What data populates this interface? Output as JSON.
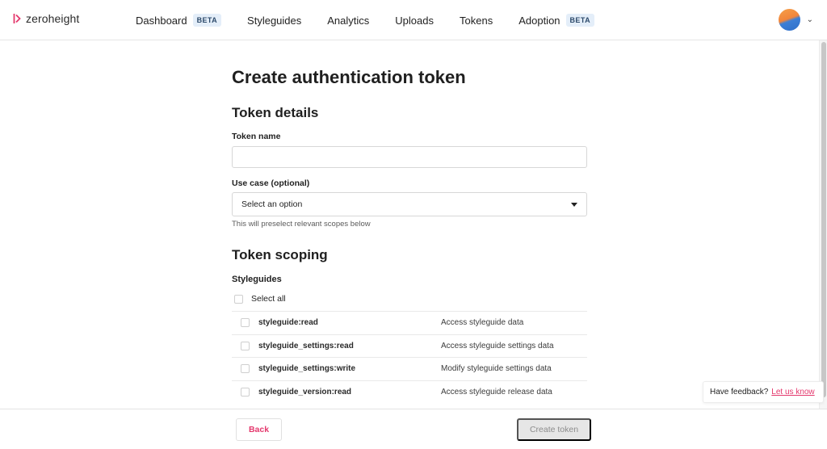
{
  "app": {
    "logo_text": "zeroheight",
    "brand_color": "#e4386d"
  },
  "nav": {
    "items": [
      {
        "label": "Dashboard",
        "badge": "BETA"
      },
      {
        "label": "Styleguides"
      },
      {
        "label": "Analytics"
      },
      {
        "label": "Uploads"
      },
      {
        "label": "Tokens"
      },
      {
        "label": "Adoption",
        "badge": "BETA"
      }
    ]
  },
  "account": {
    "avatar_icon": "avatar",
    "menu_icon": "chevron-down-icon"
  },
  "page": {
    "title": "Create authentication token"
  },
  "token_details": {
    "heading": "Token details",
    "name_label": "Token name",
    "name_value": "",
    "name_placeholder": "",
    "use_case_label": "Use case (optional)",
    "use_case_selected": "Select an option",
    "use_case_hint": "This will preselect relevant scopes below"
  },
  "scoping": {
    "heading": "Token scoping",
    "group_title": "Styleguides",
    "select_all_label": "Select all",
    "scopes": [
      {
        "name": "styleguide:read",
        "description": "Access styleguide data"
      },
      {
        "name": "styleguide_settings:read",
        "description": "Access styleguide settings data"
      },
      {
        "name": "styleguide_settings:write",
        "description": "Modify styleguide settings data"
      },
      {
        "name": "styleguide_version:read",
        "description": "Access styleguide release data"
      }
    ]
  },
  "footer": {
    "back_label": "Back",
    "create_label": "Create token"
  },
  "feedback": {
    "prompt": "Have feedback?",
    "link": "Let us know"
  }
}
